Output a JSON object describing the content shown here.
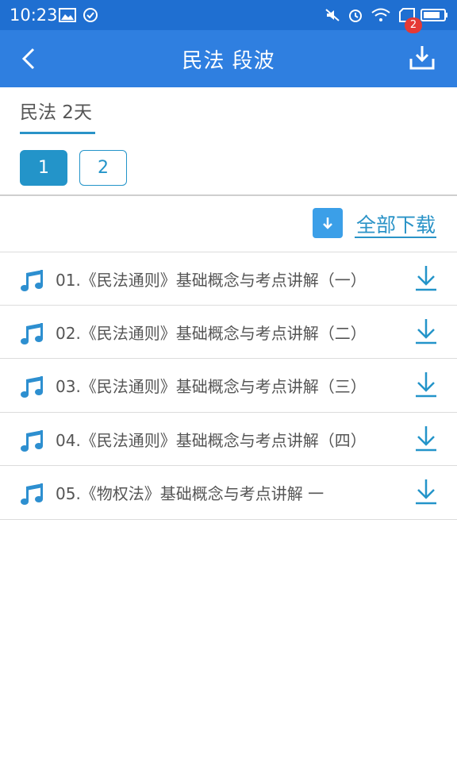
{
  "status_bar": {
    "time": "10:23"
  },
  "app_bar": {
    "title": "民法 段波",
    "download_badge": "2"
  },
  "tab": {
    "label": "民法 2天"
  },
  "pagination": {
    "pages": [
      "1",
      "2"
    ],
    "active": "1"
  },
  "download_all": {
    "label": "全部下载"
  },
  "colors": {
    "app_bar": "#2f7fe0",
    "status_bar": "#1f6fd1",
    "accent": "#2394c9",
    "music_icon": "#2d8fd0"
  },
  "items": [
    {
      "title": "01.《民法通则》基础概念与考点讲解（一）"
    },
    {
      "title": "02.《民法通则》基础概念与考点讲解（二）"
    },
    {
      "title": "03.《民法通则》基础概念与考点讲解（三）"
    },
    {
      "title": "04.《民法通则》基础概念与考点讲解（四）"
    },
    {
      "title": "05.《物权法》基础概念与考点讲解 一"
    }
  ]
}
